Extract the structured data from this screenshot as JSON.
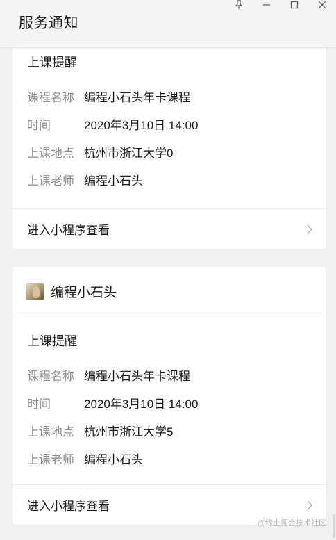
{
  "window": {
    "title": "服务通知",
    "controls": [
      "pin-icon",
      "minimize-icon",
      "maximize-icon",
      "close-icon"
    ]
  },
  "notifications": [
    {
      "sender": "",
      "notice_title": "上课提醒",
      "rows": [
        {
          "label": "课程名称",
          "value": "编程小石头年卡课程"
        },
        {
          "label": "时间",
          "value": "2020年3月10日 14:00"
        },
        {
          "label": "上课地点",
          "value": "杭州市浙江大学0"
        },
        {
          "label": "上课老师",
          "value": "编程小石头"
        }
      ],
      "link": "进入小程序查看"
    },
    {
      "sender": "编程小石头",
      "notice_title": "上课提醒",
      "rows": [
        {
          "label": "课程名称",
          "value": "编程小石头年卡课程"
        },
        {
          "label": "时间",
          "value": "2020年3月10日 14:00"
        },
        {
          "label": "上课地点",
          "value": "杭州市浙江大学5"
        },
        {
          "label": "上课老师",
          "value": "编程小石头"
        }
      ],
      "link": "进入小程序查看"
    }
  ],
  "watermark": "@稀土掘金技术社区",
  "colors": {
    "background": "#f1f1f1",
    "card": "#ffffff",
    "label": "#8a8a8a",
    "text": "#191919"
  }
}
